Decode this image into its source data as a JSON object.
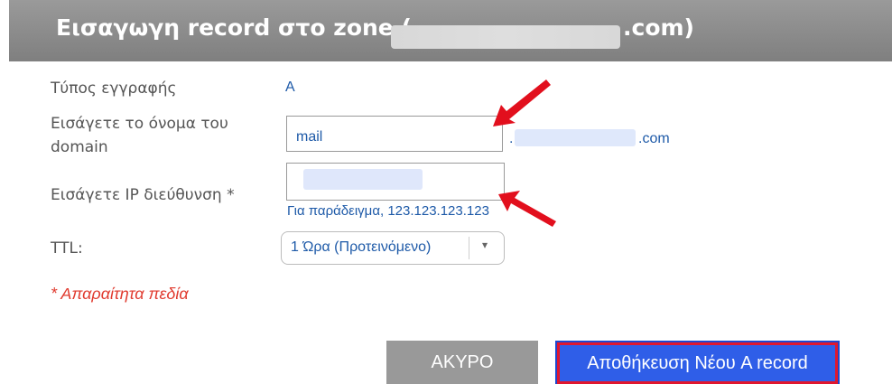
{
  "dialog": {
    "title_prefix": "Εισαγωγη record στο zone (",
    "title_suffix": ".com)"
  },
  "form": {
    "record_type_label": "Τύπος εγγραφής",
    "record_type_value": "A",
    "domain_label": "Εισάγετε το όνομα του domain",
    "domain_value": "mail",
    "domain_prefix_dot": ".",
    "domain_suffix": ".com",
    "ip_label": "Εισάγετε IP διεύθυνση *",
    "ip_example": "Για παράδειγμα, 123.123.123.123",
    "ttl_label": "TTL:",
    "ttl_value": "1 Ώρα (Προτεινόμενο)",
    "required_note": "* Απαραίτητα πεδία"
  },
  "buttons": {
    "cancel": "ΑΚΥΡΟ",
    "save": "Αποθήκευση Νέου A record"
  },
  "colors": {
    "accent": "#2f5ee8",
    "highlight": "#e0172f",
    "link": "#1e5aa8"
  }
}
